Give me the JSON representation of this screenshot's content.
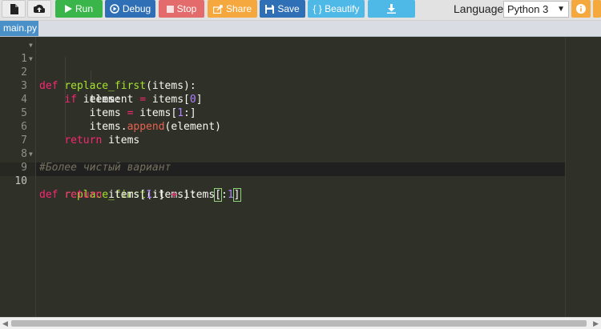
{
  "toolbar": {
    "new_file_icon": "file-icon",
    "upload_icon": "upload-icon",
    "run_label": "Run",
    "debug_label": "Debug",
    "stop_label": "Stop",
    "share_label": "Share",
    "save_label": "Save",
    "beautify_label": "{ } Beautify",
    "download_icon": "download-icon",
    "language_label": "Language",
    "language_value": "Python 3",
    "info_icon": "info-icon"
  },
  "tabs": [
    {
      "label": "main.py"
    }
  ],
  "editor": {
    "line_numbers": [
      "1",
      "2",
      "3",
      "4",
      "5",
      "6",
      "7",
      "8",
      "9",
      "10"
    ],
    "comment": "#Более чистый вариант"
  },
  "colors": {
    "run": "#3ab54a",
    "debug": "#2f6fb6",
    "stop": "#e36b6b",
    "share": "#f5a83d",
    "save": "#2f6fb6",
    "beautify": "#4eb8e6",
    "editor_bg": "#2f3129"
  }
}
